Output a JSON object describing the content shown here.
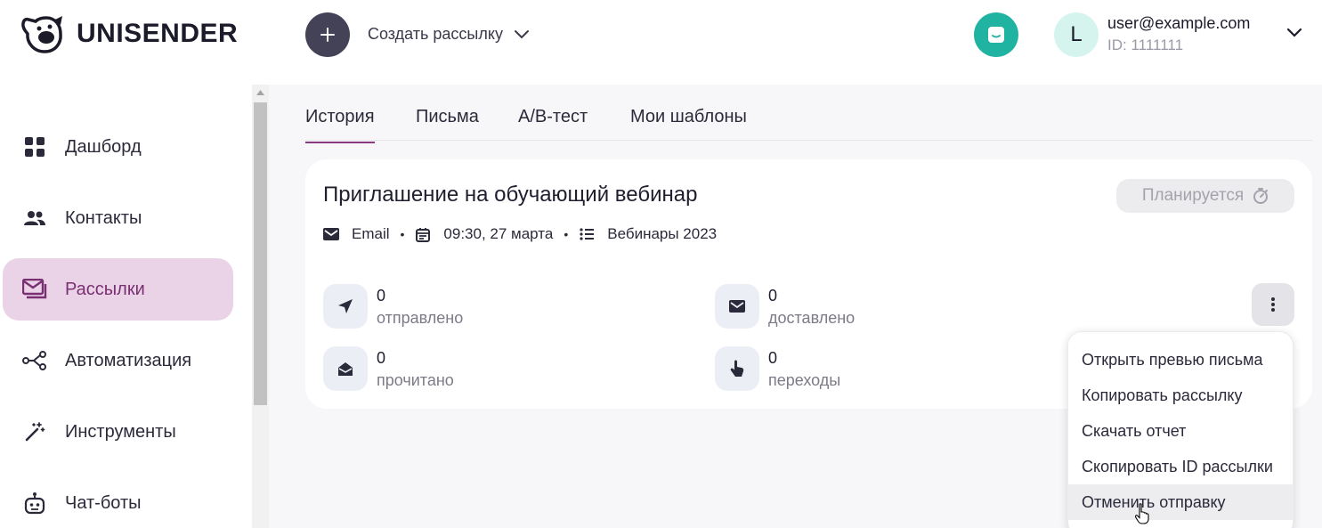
{
  "header": {
    "brand": "UNISENDER",
    "create_label": "Создать рассылку",
    "user_email": "user@example.com",
    "user_id": "ID: 1111111",
    "avatar_initial": "L"
  },
  "sidebar": {
    "items": [
      {
        "label": "Дашборд",
        "icon": "dashboard-icon"
      },
      {
        "label": "Контакты",
        "icon": "contacts-icon"
      },
      {
        "label": "Рассылки",
        "icon": "campaigns-icon",
        "active": true
      },
      {
        "label": "Автоматизация",
        "icon": "automation-icon"
      },
      {
        "label": "Инструменты",
        "icon": "tools-icon"
      },
      {
        "label": "Чат-боты",
        "icon": "chatbot-icon"
      }
    ]
  },
  "tabs": [
    {
      "label": "История",
      "active": true
    },
    {
      "label": "Письма"
    },
    {
      "label": "A/B-тест"
    },
    {
      "label": "Мои шаблоны"
    }
  ],
  "campaign": {
    "title": "Приглашение на обучающий вебинар",
    "status": "Планируется",
    "type": "Email",
    "datetime": "09:30, 27 марта",
    "list": "Вебинары 2023",
    "stats": [
      {
        "value": "0",
        "label": "отправлено",
        "icon": "send-icon"
      },
      {
        "value": "0",
        "label": "доставлено",
        "icon": "envelope-icon"
      },
      {
        "value": "0",
        "label": "прочитано",
        "icon": "open-envelope-icon"
      },
      {
        "value": "0",
        "label": "переходы",
        "icon": "click-icon"
      }
    ]
  },
  "menu": {
    "items": [
      "Открыть превью письма",
      "Копировать рассылку",
      "Скачать отчет",
      "Скопировать ID рассылки",
      "Отменить отправку"
    ],
    "hovered_index": 4
  },
  "colors": {
    "accent": "#8a3a82",
    "active_bg": "#ead3e7",
    "chat": "#21b3a2",
    "create_button": "#434257"
  }
}
